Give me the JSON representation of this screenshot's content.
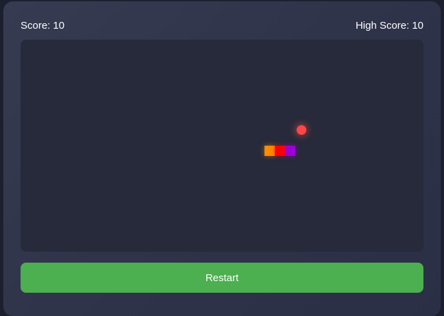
{
  "score": {
    "label": "Score:",
    "value": "10"
  },
  "high_score": {
    "label": "High Score:",
    "value": "10"
  },
  "board": {
    "food": {
      "color": "#ff4747"
    },
    "snake": {
      "segment_colors": [
        "#ff8c00",
        "#ff0000",
        "#9b00d4"
      ]
    }
  },
  "restart": {
    "label": "Restart",
    "color": "#4caf50"
  }
}
